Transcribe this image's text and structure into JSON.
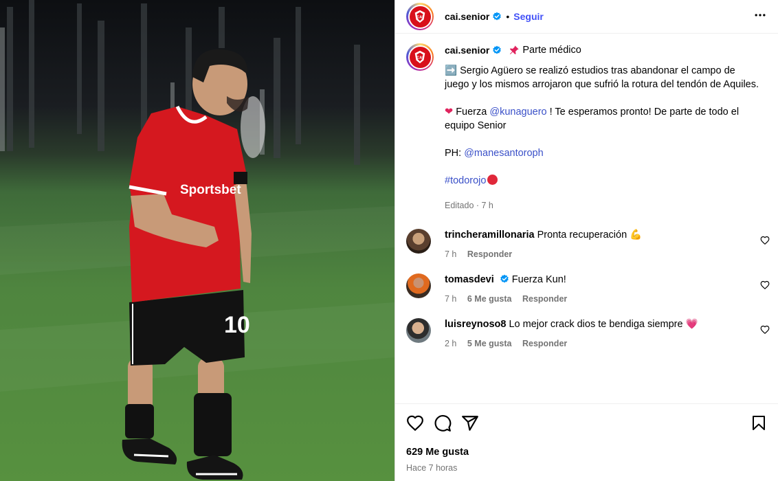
{
  "header": {
    "username": "cai.senior",
    "separator": "•",
    "follow_label": "Seguir"
  },
  "caption": {
    "username": "cai.senior",
    "title": "Parte médico",
    "paragraph1_emoji": "➡️",
    "paragraph1": "Sergio Agüero se realizó estudios tras abandonar el campo de juego y los mismos arrojaron que sufrió la rotura del tendón de Aquiles.",
    "paragraph2_pre": "Fuerza",
    "paragraph2_mention": "@kunaguero",
    "paragraph2_post": "! Te esperamos pronto! De parte de todo el equipo Senior",
    "photo_credit_label": "PH:",
    "photo_credit_mention": "@manesantoroph",
    "hashtag": "#todorojo",
    "edited": "Editado · 7 h"
  },
  "comments": [
    {
      "username": "trincheramillonaria",
      "verified": false,
      "text": "Pronta recuperación",
      "emoji": "💪",
      "time": "7 h",
      "likes": "",
      "reply": "Responder"
    },
    {
      "username": "tomasdevi",
      "verified": true,
      "text": "Fuerza Kun!",
      "emoji": "",
      "time": "7 h",
      "likes": "6 Me gusta",
      "reply": "Responder"
    },
    {
      "username": "luisreynoso8",
      "verified": false,
      "text": "Lo mejor crack dios te bendiga siempre",
      "emoji": "💗",
      "time": "2 h",
      "likes": "5 Me gusta",
      "reply": "Responder"
    }
  ],
  "footer": {
    "likes": "629 Me gusta",
    "posted_ago": "Hace 7 horas"
  },
  "photo": {
    "sponsor_text": "Sportsbet",
    "shirt_number": "10"
  },
  "colors": {
    "link": "#4150f7",
    "mention": "#3a50c8",
    "muted": "#737373",
    "verified": "#0095f6",
    "club_red": "#d8101b"
  },
  "icons": [
    "verified-icon",
    "more-icon",
    "pin-icon",
    "heart-icon",
    "comment-icon",
    "share-icon",
    "bookmark-icon"
  ]
}
